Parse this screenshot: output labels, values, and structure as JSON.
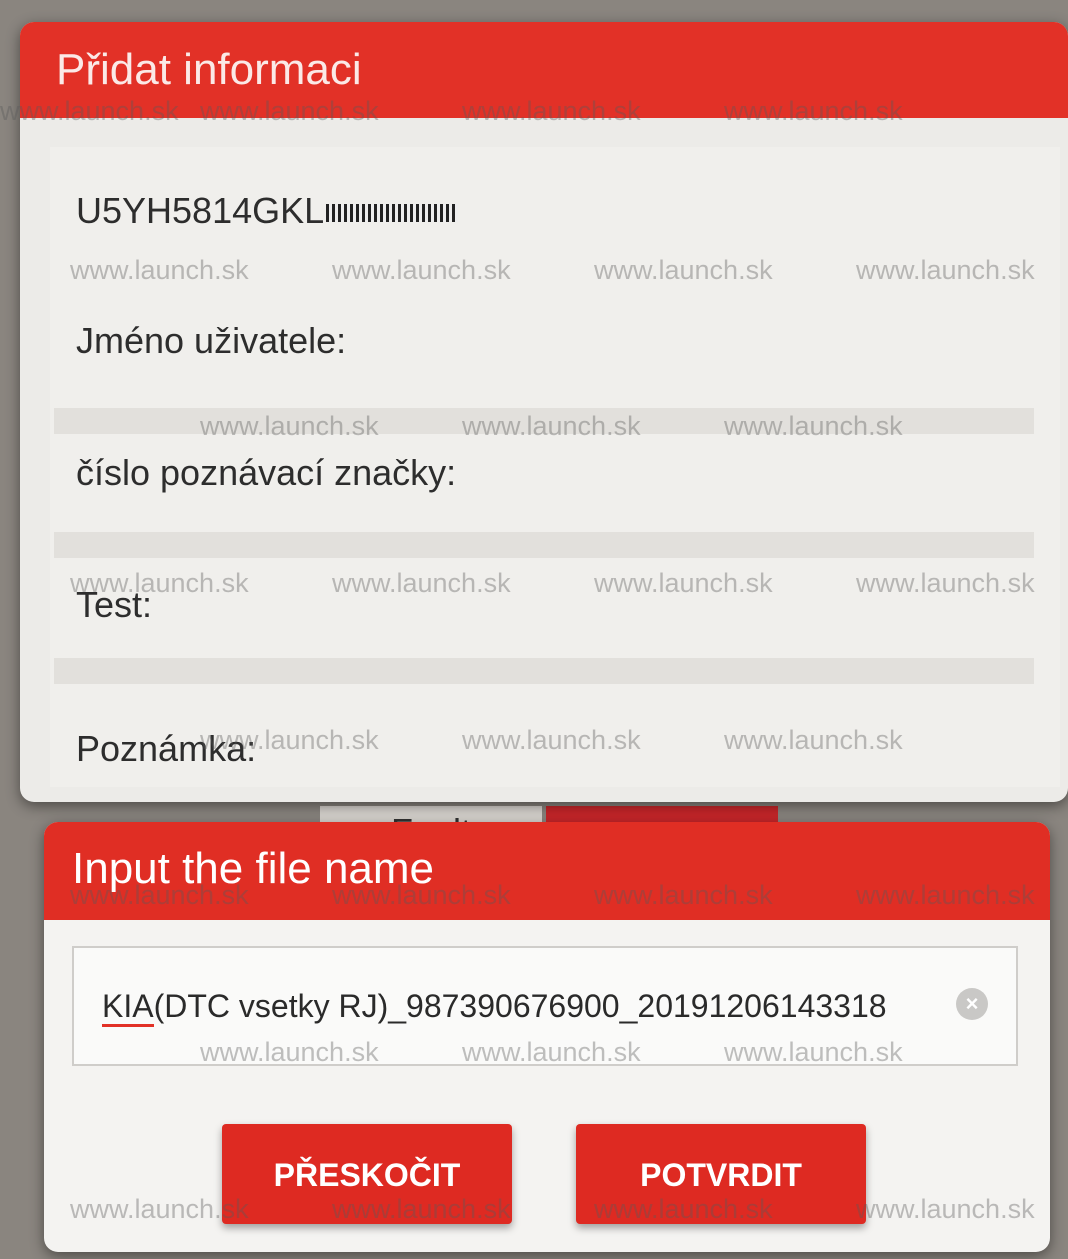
{
  "background": {
    "tab_fragment": "Fault"
  },
  "info_dialog": {
    "title": "Přidat informaci",
    "vin_prefix": "U5YH5814GKL",
    "fields": [
      {
        "label": "Jméno uživatele:"
      },
      {
        "label": "číslo poznávací značky:"
      },
      {
        "label": "Test:"
      },
      {
        "label": "Poznámka:"
      }
    ]
  },
  "file_dialog": {
    "title": "Input the file name",
    "filename_underlined_part": "KIA",
    "filename_rest": "(DTC vsetky RJ)_987390676900_20191206143318",
    "clear_icon": "clear-circle-icon",
    "buttons": {
      "skip": "PŘESKOČIT",
      "confirm": "POTVRDIT"
    }
  },
  "watermark_text": "www.launch.sk",
  "colors": {
    "accent_red": "#e23127",
    "dialog_bg": "#ecebe8"
  }
}
